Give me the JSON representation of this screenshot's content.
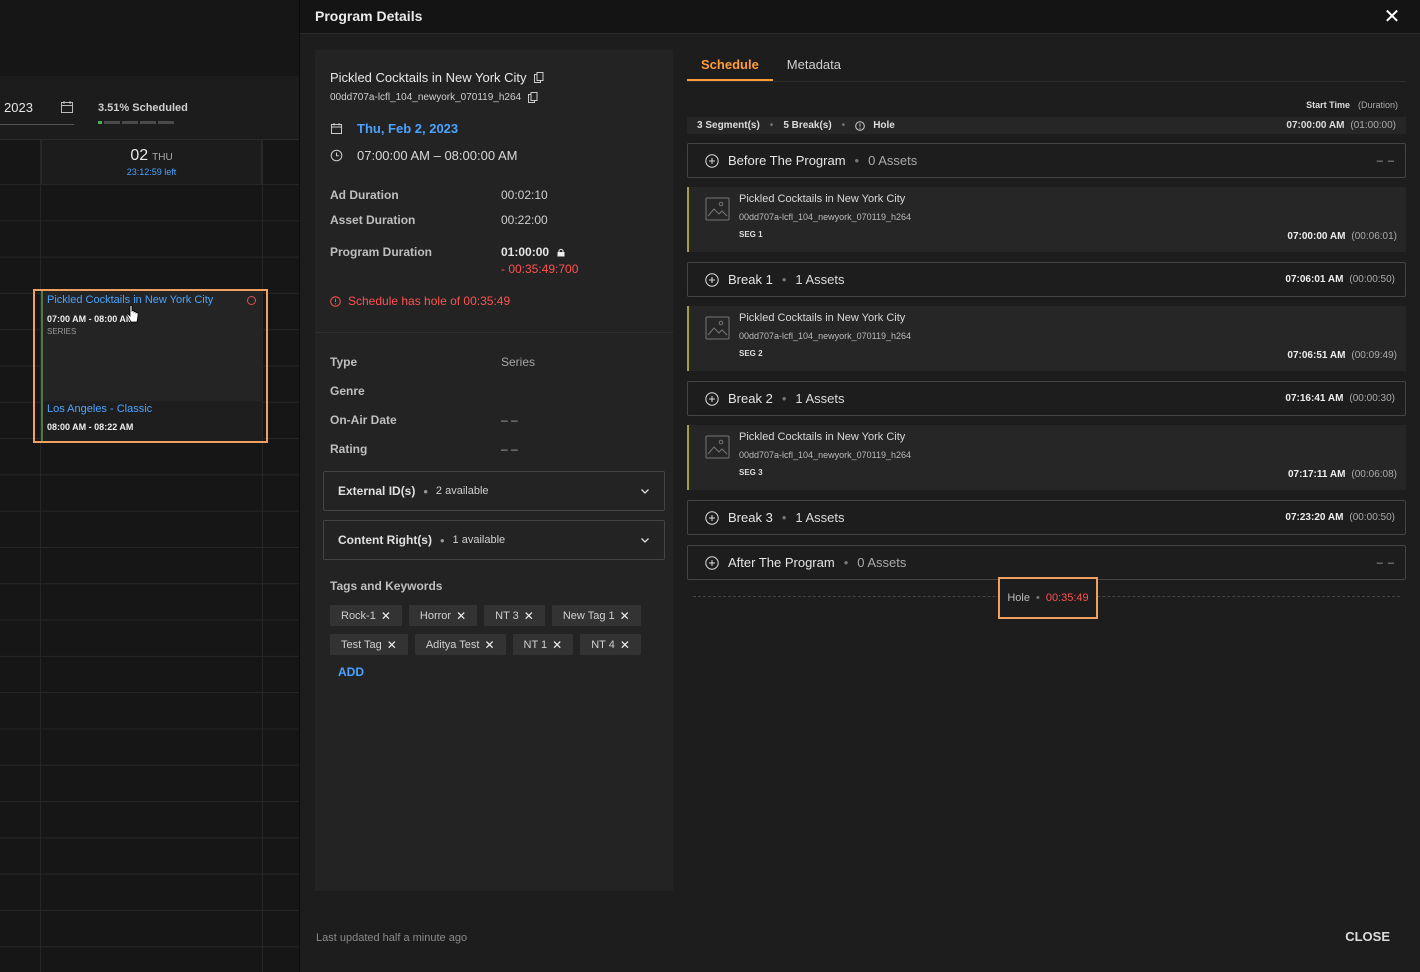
{
  "calendar": {
    "year": "2023",
    "scheduled": "3.51% Scheduled",
    "day_num": "02",
    "day_name": "THU",
    "time_left": "23:12:59 left",
    "programs": [
      {
        "title": "Pickled Cocktails in New York City",
        "time": "07:00 AM - 08:00 AM",
        "category": "SERIES"
      },
      {
        "title": "Los Angeles - Classic",
        "time": "08:00 AM - 08:22 AM"
      }
    ]
  },
  "modal": {
    "title": "Program Details",
    "close_icon": "✕",
    "footer_note": "Last updated half a minute ago",
    "close_label": "CLOSE"
  },
  "details": {
    "title": "Pickled Cocktails in New York City",
    "asset_id": "00dd707a-lcfl_104_newyork_070119_h264",
    "date": "Thu, Feb 2, 2023",
    "time_range": "07:00:00 AM – 08:00:00 AM",
    "ad_duration_label": "Ad Duration",
    "ad_duration": "00:02:10",
    "asset_duration_label": "Asset Duration",
    "asset_duration": "00:22:00",
    "program_duration_label": "Program Duration",
    "program_duration": "01:00:00",
    "program_duration_diff": "- 00:35:49:700",
    "hole_message": "Schedule has hole of 00:35:49",
    "meta": [
      {
        "label": "Type",
        "value": "Series"
      },
      {
        "label": "Genre",
        "value": ""
      },
      {
        "label": "On-Air Date",
        "value": "– –"
      },
      {
        "label": "Rating",
        "value": "– –"
      }
    ],
    "external_ids": {
      "label": "External ID(s)",
      "count": "2 available"
    },
    "content_rights": {
      "label": "Content Right(s)",
      "count": "1 available"
    },
    "tags_title": "Tags and Keywords",
    "tags": [
      "Rock-1",
      "Horror",
      "NT 3",
      "New Tag 1",
      "Test Tag",
      "Aditya Test",
      "NT 1",
      "NT 4"
    ],
    "add_label": "ADD"
  },
  "schedule": {
    "tabs": [
      "Schedule",
      "Metadata"
    ],
    "start_time_label": "Start Time",
    "duration_label": "(Duration)",
    "summary": {
      "segments": "3 Segment(s)",
      "breaks": "5 Break(s)",
      "hole": "Hole",
      "start": "07:00:00 AM",
      "duration": "(01:00:00)"
    },
    "before": {
      "name": "Before The Program",
      "count": "0 Assets",
      "time": "– –"
    },
    "rows": [
      {
        "kind": "seg",
        "title": "Pickled Cocktails in New York City",
        "id": "00dd707a-lcfl_104_newyork_070119_h264",
        "seg": "SEG 1",
        "start": "07:00:00 AM",
        "dur": "(00:06:01)"
      },
      {
        "kind": "brk",
        "name": "Break 1",
        "count": "1 Assets",
        "start": "07:06:01 AM",
        "dur": "(00:00:50)"
      },
      {
        "kind": "seg",
        "title": "Pickled Cocktails in New York City",
        "id": "00dd707a-lcfl_104_newyork_070119_h264",
        "seg": "SEG 2",
        "start": "07:06:51 AM",
        "dur": "(00:09:49)"
      },
      {
        "kind": "brk",
        "name": "Break 2",
        "count": "1 Assets",
        "start": "07:16:41 AM",
        "dur": "(00:00:30)"
      },
      {
        "kind": "seg",
        "title": "Pickled Cocktails in New York City",
        "id": "00dd707a-lcfl_104_newyork_070119_h264",
        "seg": "SEG 3",
        "start": "07:17:11 AM",
        "dur": "(00:06:08)"
      },
      {
        "kind": "brk",
        "name": "Break 3",
        "count": "1 Assets",
        "start": "07:23:20 AM",
        "dur": "(00:00:50)"
      }
    ],
    "after": {
      "name": "After The Program",
      "count": "0 Assets",
      "time": "– –"
    },
    "hole_label": "Hole",
    "hole_value": "00:35:49"
  },
  "colors": {
    "accent": "#ff9c3a",
    "link": "#4aa3ff",
    "error": "#ff5252",
    "highlight": "#f0a060"
  }
}
